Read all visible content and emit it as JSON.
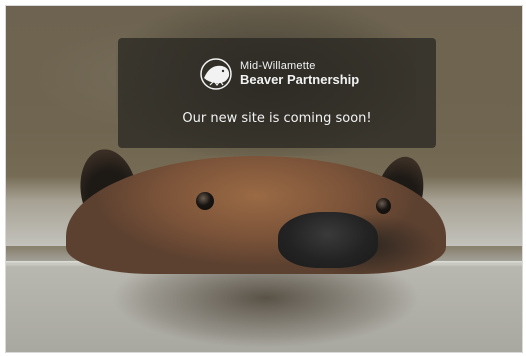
{
  "brand": {
    "line1": "Mid-Willamette",
    "line2": "Beaver Partnership",
    "logo_icon": "beaver-logo-icon"
  },
  "message": "Our new site is coming soon!",
  "background": {
    "subject": "beaver swimming in water",
    "overlay_color": "#26241f"
  }
}
